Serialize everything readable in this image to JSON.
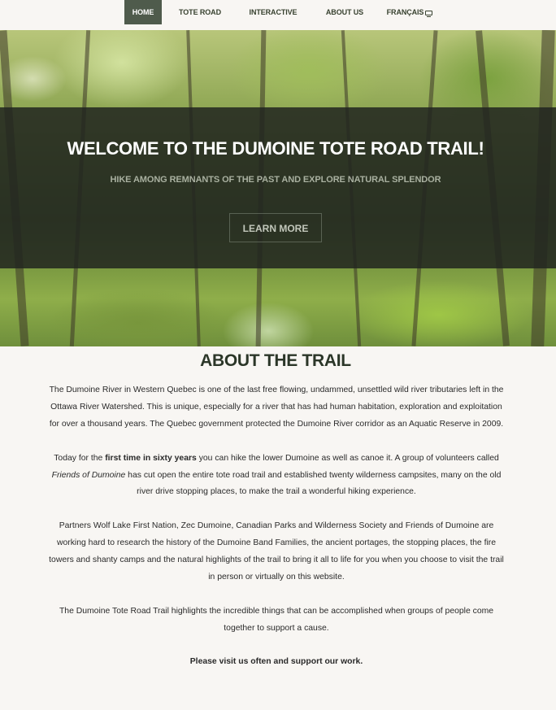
{
  "nav": {
    "items": [
      {
        "label": "HOME",
        "active": true
      },
      {
        "label": "TOTE ROAD",
        "active": false
      },
      {
        "label": "INTERACTIVE MAP",
        "active": false
      },
      {
        "label": "ABOUT US",
        "active": false
      },
      {
        "label": "FRANÇAIS",
        "active": false,
        "icon": "monitor-icon"
      }
    ],
    "active_color": "#4f5b4c"
  },
  "hero": {
    "title": "WELCOME TO THE DUMOINE TOTE ROAD TRAIL!",
    "subtitle": "HIKE AMONG REMNANTS OF THE PAST AND EXPLORE NATURAL SPLENDOR",
    "button_label": "LEARN MORE"
  },
  "about": {
    "heading": "ABOUT THE TRAIL",
    "p1": "The Dumoine River in Western Quebec is one of the last free flowing, undammed, unsettled wild river tributaries left in the Ottawa River Watershed. This is unique, especially for a river that has had human habitation, exploration and exploitation for over a thousand years. The Quebec government protected the Dumoine River corridor as an Aquatic Reserve in 2009.",
    "p2_before": "Today for the ",
    "p2_bold": "first time in sixty years",
    "p2_middle": " you can hike the lower Dumoine as well as canoe it. A group of volunteers called ",
    "p2_italic": "Friends of Dumoine",
    "p2_after": " has cut open the entire tote road trail and established twenty wilderness campsites, many on the old river drive stopping places, to make the trail a wonderful hiking experience.",
    "p3": "Partners Wolf Lake First Nation, Zec Dumoine, Canadian Parks and Wilderness Society and Friends of Dumoine are working hard to research the history of the Dumoine Band Families, the ancient portages, the stopping places, the fire towers and shanty camps and the natural highlights of the trail to bring it all to life for you when you choose to visit the trail in person or virtually on this website.",
    "p4": "The Dumoine Tote Road Trail highlights the incredible things that can be accomplished when groups of people come together to support a cause.",
    "closing": "Please visit us often and support our work."
  }
}
